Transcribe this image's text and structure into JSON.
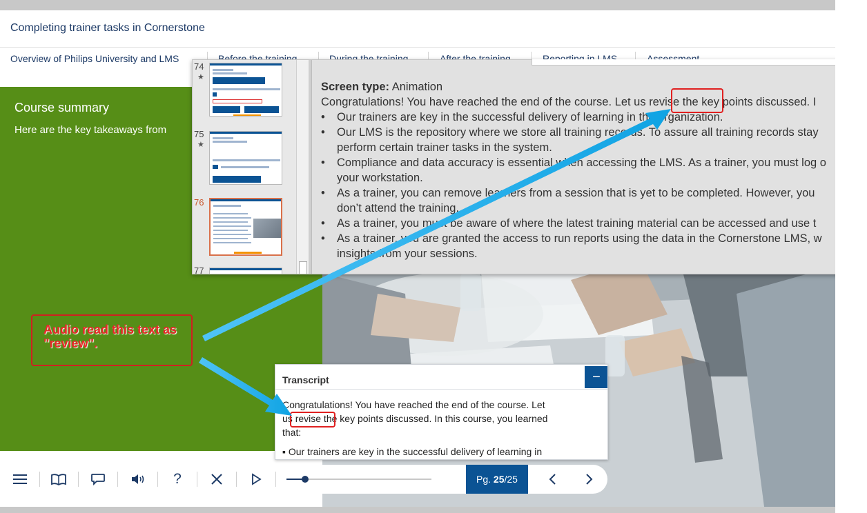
{
  "header": {
    "title": "Completing trainer tasks in Cornerstone"
  },
  "tabs": [
    {
      "label": "Overview of Philips University and LMS"
    },
    {
      "label": "Before the training"
    },
    {
      "label": "During the training"
    },
    {
      "label": "After the training"
    },
    {
      "label": "Reporting in LMS"
    },
    {
      "label": "Assessment"
    }
  ],
  "course": {
    "title": "Course summary",
    "text": "Here are the key takeaways from"
  },
  "slides": [
    {
      "number": "74",
      "starred": "★"
    },
    {
      "number": "75",
      "starred": "★"
    },
    {
      "number": "76",
      "starred": ""
    },
    {
      "number": "77",
      "starred": ""
    }
  ],
  "notes": {
    "screen_type_label": "Screen type:",
    "screen_type_value": "Animation",
    "intro_before": "Congratulations! You have reached the end of the course. Let ",
    "intro_us": "us ",
    "intro_word": "revise",
    "intro_after": " the key points discussed. I",
    "bullets": [
      "Our trainers are key in the successful delivery of learning in the organization.",
      "Our LMS is the repository where we store all training records. To assure all training records stay",
      "perform certain trainer tasks in the system.",
      "Compliance and data accuracy is essential when accessing the LMS. As a trainer, you must log o",
      "your workstation.",
      "As a trainer, you can remove learners from a session that is yet to be completed. However, you",
      "don’t attend the training.",
      "As a trainer, you must be aware of where the latest training material can be accessed and use t",
      "As a trainer, you are granted the access to run reports using the data in the Cornerstone LMS, w",
      "insights from your sessions."
    ]
  },
  "transcript": {
    "title": "Transcript",
    "minimize_symbol": "−",
    "line1": "Congratulations! You have reached the end of the course. Let",
    "line2_before": "us ",
    "line2_word": "revise",
    "line2_after": " the key points discussed. In this course, you learned",
    "line3": "that:",
    "bullet": "▪  Our trainers are key in the successful delivery of learning in"
  },
  "callout": {
    "text": "Audio read this text as\n\"review\"."
  },
  "toolbar": {
    "page_prefix": "Pg. ",
    "page_current": "25",
    "page_total": "/25",
    "progress": 0.13
  }
}
